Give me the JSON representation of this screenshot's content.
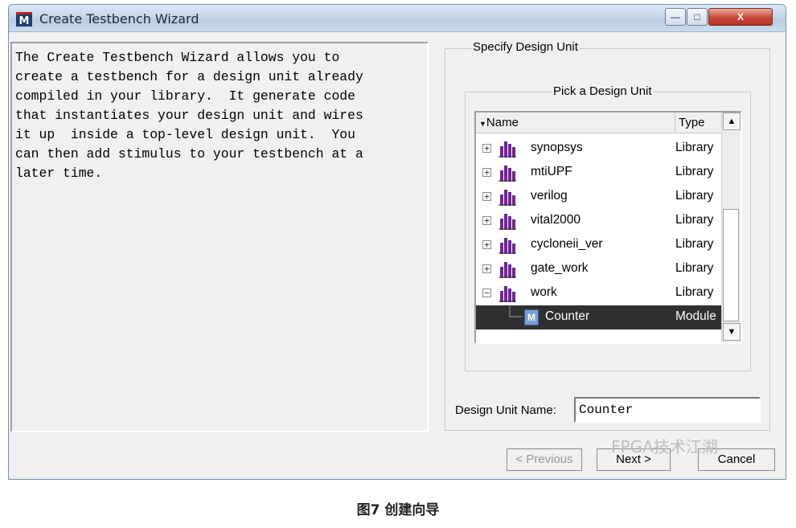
{
  "window": {
    "title": "Create Testbench Wizard",
    "icon_letter": "M",
    "controls": {
      "minimize": "—",
      "maximize": "□",
      "close": "X"
    }
  },
  "description": "The Create Testbench Wizard allows you to\ncreate a testbench for a design unit already\ncompiled in your library.  It generate code\nthat instantiates your design unit and wires\nit up  inside a top-level design unit.  You\ncan then add stimulus to your testbench at a\nlater time.",
  "specify_group": {
    "label": "Specify Design Unit",
    "pick_label": "Pick a Design Unit",
    "columns": {
      "name": "Name",
      "type": "Type"
    },
    "rows": [
      {
        "name": "synopsys",
        "type": "Library",
        "expander": "+"
      },
      {
        "name": "mtiUPF",
        "type": "Library",
        "expander": "+"
      },
      {
        "name": "verilog",
        "type": "Library",
        "expander": "+"
      },
      {
        "name": "vital2000",
        "type": "Library",
        "expander": "+"
      },
      {
        "name": "cycloneii_ver",
        "type": "Library",
        "expander": "+"
      },
      {
        "name": "gate_work",
        "type": "Library",
        "expander": "+"
      },
      {
        "name": "work",
        "type": "Library",
        "expander": "−"
      }
    ],
    "selected_row": {
      "name": "Counter",
      "type": "Module",
      "icon_letter": "M"
    },
    "design_unit_name_label": "Design Unit Name:",
    "design_unit_name_value": "Counter"
  },
  "buttons": {
    "previous": "< Previous",
    "next": "Next >",
    "cancel": "Cancel"
  },
  "watermark": "FPGA技术江湖",
  "caption": "图7 创建向导",
  "colors": {
    "selection": "#303030",
    "library_icon": "#6a2a8a"
  }
}
